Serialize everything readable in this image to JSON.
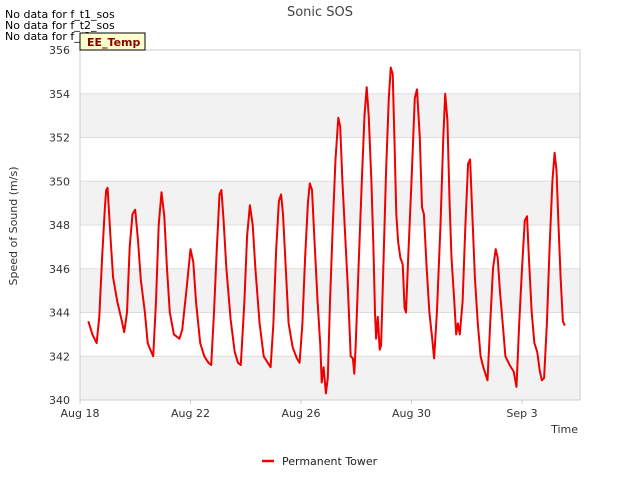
{
  "colors": {
    "series": "#ee0000",
    "band_shade": "#f2f2f2",
    "grid": "#dddddd",
    "tooltip_bg": "#ffffcc",
    "tooltip_text": "#8b0000"
  },
  "no_data_messages": [
    "No data for f_t1_sos",
    "No data for f_t2_sos",
    "No data for f_t3_sos"
  ],
  "tooltip_label": "EE_Temp",
  "chart_data": {
    "type": "line",
    "title": "Sonic SOS",
    "xlabel": "Time",
    "ylabel": "Speed of Sound (m/s)",
    "ylim": [
      340,
      356
    ],
    "xlim": [
      0,
      18.1
    ],
    "yticks": [
      340,
      342,
      344,
      346,
      348,
      350,
      352,
      354,
      356
    ],
    "xticks": [
      {
        "x": 0,
        "label": "Aug 18"
      },
      {
        "x": 4,
        "label": "Aug 22"
      },
      {
        "x": 8,
        "label": "Aug 26"
      },
      {
        "x": 12,
        "label": "Aug 30"
      },
      {
        "x": 16,
        "label": "Sep 3"
      }
    ],
    "grid": true,
    "legend_position": "bottom",
    "series": [
      {
        "name": "Permanent Tower",
        "points": [
          [
            0.3,
            343.6
          ],
          [
            0.45,
            343.0
          ],
          [
            0.6,
            342.6
          ],
          [
            0.7,
            343.8
          ],
          [
            0.8,
            346.5
          ],
          [
            0.9,
            348.8
          ],
          [
            0.95,
            349.6
          ],
          [
            1.0,
            349.7
          ],
          [
            1.1,
            347.5
          ],
          [
            1.2,
            345.6
          ],
          [
            1.35,
            344.5
          ],
          [
            1.5,
            343.7
          ],
          [
            1.6,
            343.1
          ],
          [
            1.7,
            344.0
          ],
          [
            1.8,
            347.0
          ],
          [
            1.9,
            348.5
          ],
          [
            2.0,
            348.7
          ],
          [
            2.1,
            347.3
          ],
          [
            2.2,
            345.5
          ],
          [
            2.35,
            344.0
          ],
          [
            2.45,
            342.6
          ],
          [
            2.55,
            342.3
          ],
          [
            2.65,
            342.0
          ],
          [
            2.75,
            344.5
          ],
          [
            2.85,
            348.0
          ],
          [
            2.95,
            349.5
          ],
          [
            3.05,
            348.4
          ],
          [
            3.15,
            346.0
          ],
          [
            3.25,
            344.0
          ],
          [
            3.4,
            343.0
          ],
          [
            3.6,
            342.8
          ],
          [
            3.7,
            343.2
          ],
          [
            3.85,
            345.0
          ],
          [
            4.0,
            346.9
          ],
          [
            4.1,
            346.3
          ],
          [
            4.2,
            344.5
          ],
          [
            4.35,
            342.6
          ],
          [
            4.5,
            342.0
          ],
          [
            4.65,
            341.7
          ],
          [
            4.75,
            341.6
          ],
          [
            4.85,
            344.0
          ],
          [
            4.95,
            346.8
          ],
          [
            5.05,
            349.4
          ],
          [
            5.12,
            349.6
          ],
          [
            5.2,
            348.2
          ],
          [
            5.3,
            346.0
          ],
          [
            5.45,
            343.7
          ],
          [
            5.6,
            342.2
          ],
          [
            5.72,
            341.7
          ],
          [
            5.82,
            341.6
          ],
          [
            5.95,
            344.5
          ],
          [
            6.05,
            347.5
          ],
          [
            6.15,
            348.9
          ],
          [
            6.25,
            348.0
          ],
          [
            6.35,
            346.0
          ],
          [
            6.5,
            343.5
          ],
          [
            6.65,
            342.0
          ],
          [
            6.8,
            341.7
          ],
          [
            6.9,
            341.5
          ],
          [
            7.0,
            343.5
          ],
          [
            7.1,
            346.8
          ],
          [
            7.2,
            349.1
          ],
          [
            7.28,
            349.4
          ],
          [
            7.35,
            348.5
          ],
          [
            7.45,
            346.0
          ],
          [
            7.55,
            343.5
          ],
          [
            7.7,
            342.4
          ],
          [
            7.85,
            341.9
          ],
          [
            7.95,
            341.7
          ],
          [
            8.05,
            343.5
          ],
          [
            8.15,
            346.5
          ],
          [
            8.25,
            349.0
          ],
          [
            8.32,
            349.9
          ],
          [
            8.4,
            349.6
          ],
          [
            8.5,
            347.0
          ],
          [
            8.6,
            344.5
          ],
          [
            8.7,
            342.5
          ],
          [
            8.75,
            340.8
          ],
          [
            8.82,
            341.5
          ],
          [
            8.9,
            340.3
          ],
          [
            8.97,
            341.0
          ],
          [
            9.05,
            344.5
          ],
          [
            9.15,
            348.0
          ],
          [
            9.25,
            351.0
          ],
          [
            9.35,
            352.9
          ],
          [
            9.42,
            352.5
          ],
          [
            9.5,
            350.0
          ],
          [
            9.6,
            347.5
          ],
          [
            9.7,
            345.0
          ],
          [
            9.8,
            342.0
          ],
          [
            9.88,
            341.9
          ],
          [
            9.93,
            341.2
          ],
          [
            9.98,
            342.5
          ],
          [
            10.08,
            346.0
          ],
          [
            10.2,
            350.0
          ],
          [
            10.3,
            353.0
          ],
          [
            10.38,
            354.3
          ],
          [
            10.45,
            353.0
          ],
          [
            10.55,
            350.0
          ],
          [
            10.62,
            347.0
          ],
          [
            10.68,
            344.0
          ],
          [
            10.72,
            342.8
          ],
          [
            10.78,
            343.8
          ],
          [
            10.85,
            342.3
          ],
          [
            10.9,
            342.5
          ],
          [
            10.98,
            346.0
          ],
          [
            11.08,
            350.5
          ],
          [
            11.18,
            353.8
          ],
          [
            11.25,
            355.2
          ],
          [
            11.32,
            354.9
          ],
          [
            11.38,
            352.0
          ],
          [
            11.45,
            348.5
          ],
          [
            11.52,
            347.2
          ],
          [
            11.6,
            346.5
          ],
          [
            11.68,
            346.2
          ],
          [
            11.75,
            344.2
          ],
          [
            11.8,
            344.0
          ],
          [
            11.88,
            346.5
          ],
          [
            12.0,
            350.0
          ],
          [
            12.12,
            353.8
          ],
          [
            12.2,
            354.2
          ],
          [
            12.3,
            352.0
          ],
          [
            12.38,
            348.8
          ],
          [
            12.45,
            348.5
          ],
          [
            12.55,
            346.0
          ],
          [
            12.65,
            344.0
          ],
          [
            12.75,
            342.8
          ],
          [
            12.82,
            341.9
          ],
          [
            12.92,
            344.0
          ],
          [
            13.05,
            348.0
          ],
          [
            13.15,
            352.0
          ],
          [
            13.22,
            354.0
          ],
          [
            13.3,
            352.8
          ],
          [
            13.38,
            349.0
          ],
          [
            13.45,
            346.5
          ],
          [
            13.55,
            344.5
          ],
          [
            13.62,
            343.0
          ],
          [
            13.68,
            343.5
          ],
          [
            13.75,
            343.0
          ],
          [
            13.85,
            344.5
          ],
          [
            13.95,
            348.0
          ],
          [
            14.05,
            350.8
          ],
          [
            14.12,
            351.0
          ],
          [
            14.2,
            348.5
          ],
          [
            14.3,
            345.5
          ],
          [
            14.4,
            343.5
          ],
          [
            14.5,
            342.0
          ],
          [
            14.6,
            341.5
          ],
          [
            14.7,
            341.1
          ],
          [
            14.75,
            340.9
          ],
          [
            14.85,
            343.5
          ],
          [
            14.95,
            346.0
          ],
          [
            15.05,
            346.9
          ],
          [
            15.12,
            346.5
          ],
          [
            15.2,
            345.0
          ],
          [
            15.3,
            343.5
          ],
          [
            15.4,
            342.0
          ],
          [
            15.55,
            341.6
          ],
          [
            15.7,
            341.3
          ],
          [
            15.8,
            340.6
          ],
          [
            15.9,
            343.5
          ],
          [
            16.0,
            346.0
          ],
          [
            16.1,
            348.2
          ],
          [
            16.18,
            348.4
          ],
          [
            16.25,
            346.5
          ],
          [
            16.35,
            344.0
          ],
          [
            16.45,
            342.6
          ],
          [
            16.55,
            342.2
          ],
          [
            16.65,
            341.3
          ],
          [
            16.72,
            340.9
          ],
          [
            16.8,
            341.0
          ],
          [
            16.9,
            343.5
          ],
          [
            17.0,
            347.0
          ],
          [
            17.1,
            350.0
          ],
          [
            17.18,
            351.3
          ],
          [
            17.25,
            350.5
          ],
          [
            17.32,
            348.0
          ],
          [
            17.4,
            345.5
          ],
          [
            17.48,
            343.6
          ],
          [
            17.55,
            343.4
          ]
        ]
      }
    ]
  }
}
